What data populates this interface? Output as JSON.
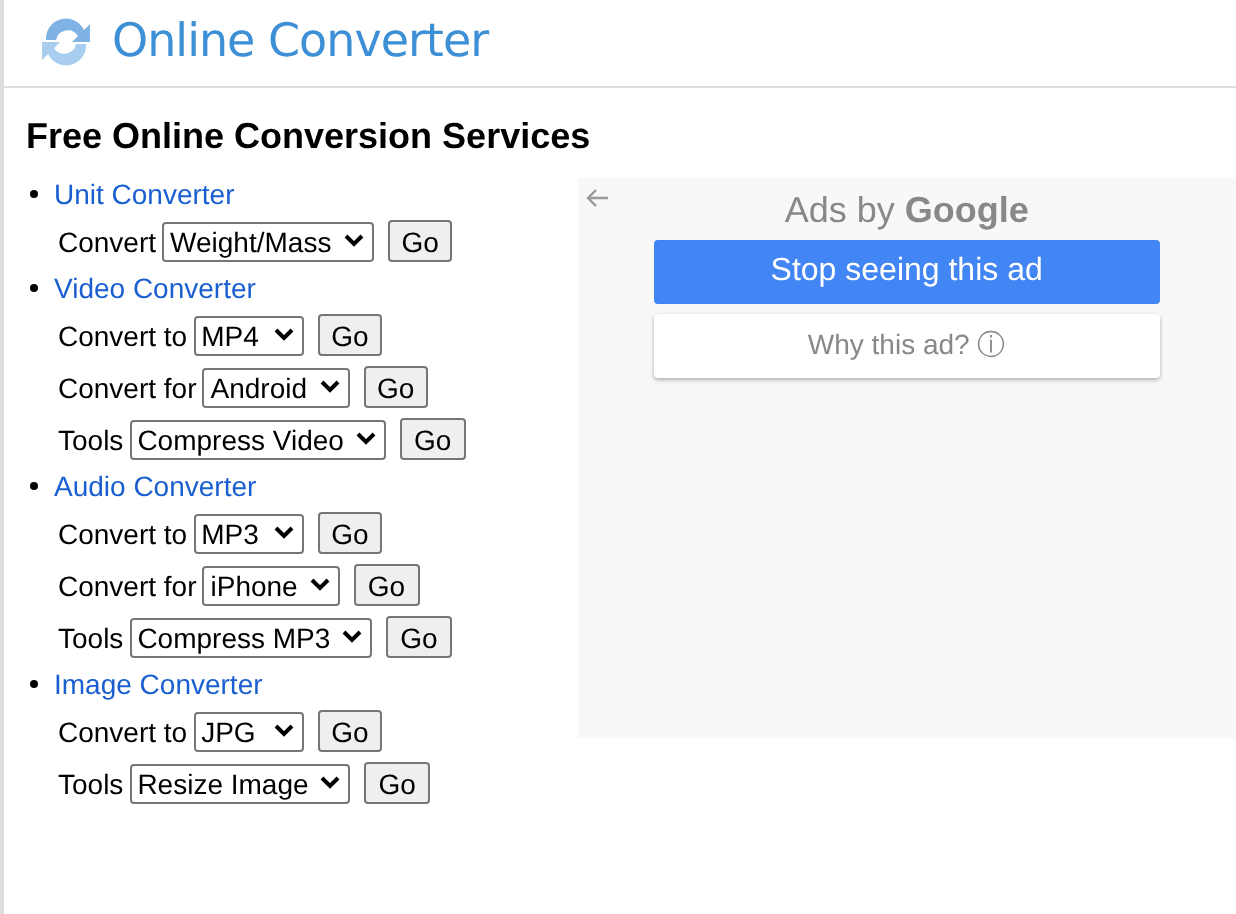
{
  "header": {
    "title": "Online Converter"
  },
  "heading": "Free Online Conversion Services",
  "sections": [
    {
      "title": "Unit Converter",
      "rows": [
        {
          "label": "Convert",
          "value": "Weight/Mass",
          "button": "Go"
        }
      ]
    },
    {
      "title": "Video Converter",
      "rows": [
        {
          "label": "Convert to",
          "value": "MP4",
          "button": "Go"
        },
        {
          "label": "Convert for",
          "value": "Android",
          "button": "Go"
        },
        {
          "label": "Tools",
          "value": "Compress Video",
          "button": "Go"
        }
      ]
    },
    {
      "title": "Audio Converter",
      "rows": [
        {
          "label": "Convert to",
          "value": "MP3",
          "button": "Go"
        },
        {
          "label": "Convert for",
          "value": "iPhone",
          "button": "Go"
        },
        {
          "label": "Tools",
          "value": "Compress MP3",
          "button": "Go"
        }
      ]
    },
    {
      "title": "Image Converter",
      "rows": [
        {
          "label": "Convert to",
          "value": "JPG",
          "button": "Go"
        },
        {
          "label": "Tools",
          "value": "Resize Image",
          "button": "Go"
        }
      ]
    }
  ],
  "ad": {
    "brand": "Ads by **Google**",
    "stop_button": "Stop seeing this ad",
    "why_button": "Why this ad? ⓘ"
  }
}
